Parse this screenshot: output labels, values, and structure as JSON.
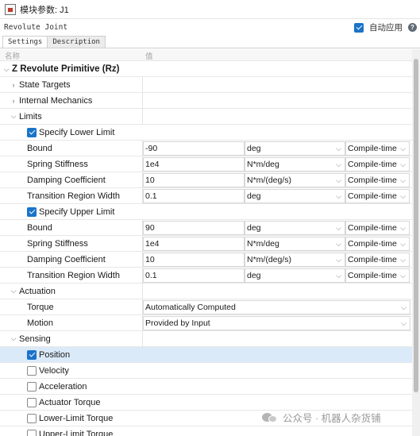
{
  "window": {
    "title": "模块参数: J1",
    "block_type": "Revolute Joint",
    "auto_apply_label": "自动应用",
    "auto_apply_checked": true
  },
  "tabs": [
    {
      "label": "Settings",
      "active": true
    },
    {
      "label": "Description",
      "active": false
    }
  ],
  "columns": {
    "name": "名称",
    "value": "值"
  },
  "section": "Z Revolute Primitive (Rz)",
  "groups": {
    "state_targets": "State Targets",
    "internal_mechanics": "Internal Mechanics",
    "limits": "Limits",
    "actuation": "Actuation",
    "sensing": "Sensing"
  },
  "limits": {
    "lower": {
      "label": "Specify Lower Limit",
      "checked": true,
      "params": [
        {
          "name": "Bound",
          "value": "-90",
          "unit": "deg",
          "rt": "Compile-time"
        },
        {
          "name": "Spring Stiffness",
          "value": "1e4",
          "unit": "N*m/deg",
          "rt": "Compile-time"
        },
        {
          "name": "Damping Coefficient",
          "value": "10",
          "unit": "N*m/(deg/s)",
          "rt": "Compile-time"
        },
        {
          "name": "Transition Region Width",
          "value": "0.1",
          "unit": "deg",
          "rt": "Compile-time"
        }
      ]
    },
    "upper": {
      "label": "Specify Upper Limit",
      "checked": true,
      "params": [
        {
          "name": "Bound",
          "value": "90",
          "unit": "deg",
          "rt": "Compile-time"
        },
        {
          "name": "Spring Stiffness",
          "value": "1e4",
          "unit": "N*m/deg",
          "rt": "Compile-time"
        },
        {
          "name": "Damping Coefficient",
          "value": "10",
          "unit": "N*m/(deg/s)",
          "rt": "Compile-time"
        },
        {
          "name": "Transition Region Width",
          "value": "0.1",
          "unit": "deg",
          "rt": "Compile-time"
        }
      ]
    }
  },
  "actuation": {
    "torque_label": "Torque",
    "torque_value": "Automatically Computed",
    "motion_label": "Motion",
    "motion_value": "Provided by Input"
  },
  "sensing": [
    {
      "label": "Position",
      "checked": true,
      "selected": true
    },
    {
      "label": "Velocity",
      "checked": false,
      "selected": false
    },
    {
      "label": "Acceleration",
      "checked": false,
      "selected": false
    },
    {
      "label": "Actuator Torque",
      "checked": false,
      "selected": false
    },
    {
      "label": "Lower-Limit Torque",
      "checked": false,
      "selected": false
    },
    {
      "label": "Upper-Limit Torque",
      "checked": false,
      "selected": false
    }
  ],
  "watermark": "公众号 · 机器人杂货铺",
  "icons": {
    "collapsed": "chevron-right-icon",
    "expanded": "chevron-down-icon",
    "help": "help-icon",
    "dropdown": "chevron-down-icon"
  },
  "colors": {
    "accent": "#1a73c9",
    "selected_row": "#dbeaf8"
  }
}
